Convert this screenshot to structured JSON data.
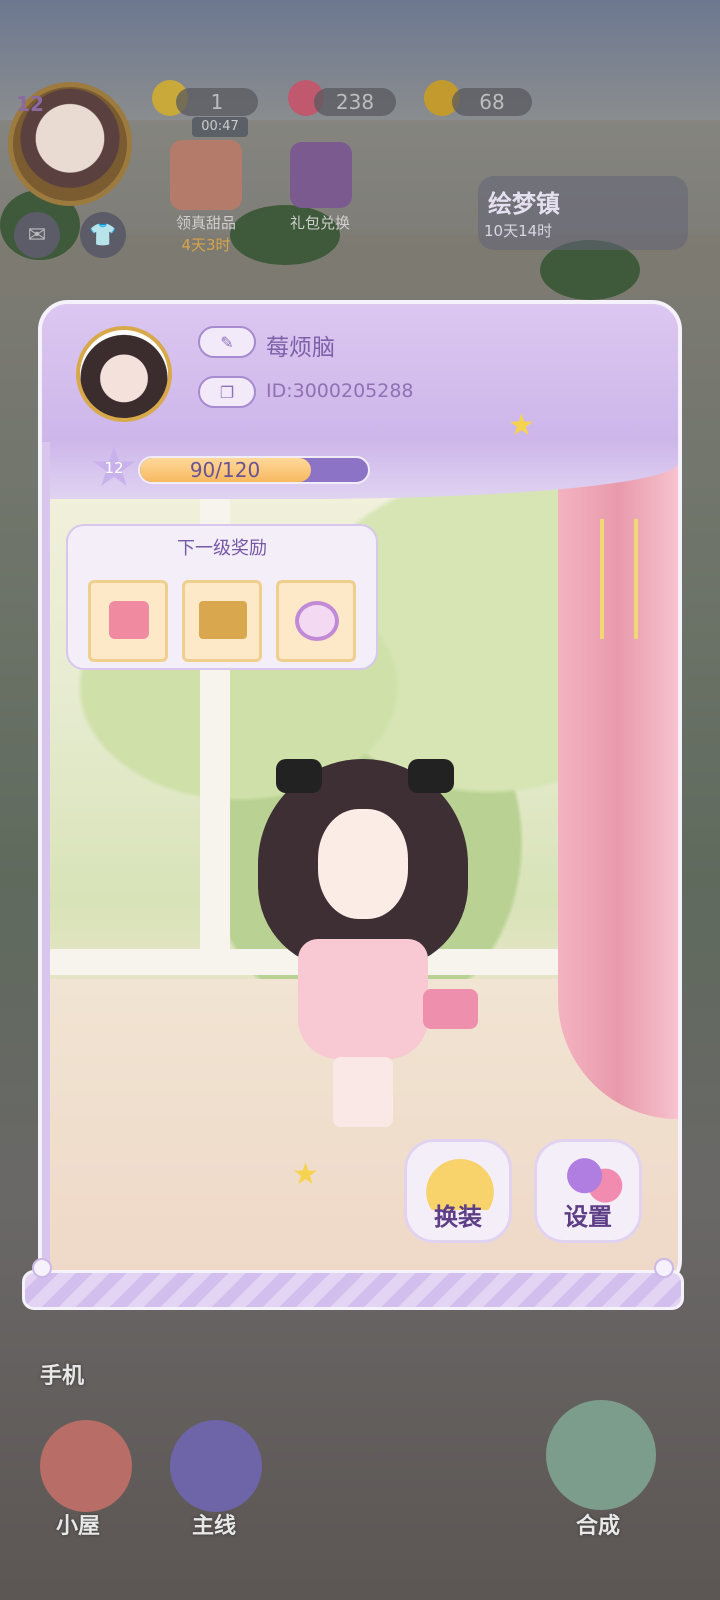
{
  "hud": {
    "player_level": "12",
    "energy": "1",
    "energy_timer": "00:47",
    "gems": "238",
    "coins": "68"
  },
  "events": [
    {
      "label": "领真甜品",
      "sub": "4天3时"
    },
    {
      "label": "礼包兑换",
      "sub": ""
    }
  ],
  "dream_town": {
    "label": "绘梦镇",
    "sub": "10天14时"
  },
  "side": {
    "phone_label": "手机"
  },
  "bottom_nav": [
    {
      "label": "小屋"
    },
    {
      "label": "主线"
    },
    {
      "label": "合成"
    }
  ],
  "profile": {
    "name": "莓烦脑",
    "id": "ID:3000205288",
    "level": "12",
    "xp_text": "90/120",
    "xp_fraction": 0.75,
    "reward_title": "下一级奖励",
    "rewards": [
      {
        "icon": "pink-bag-icon"
      },
      {
        "icon": "treasure-box-icon"
      },
      {
        "icon": "compact-mirror-icon"
      }
    ],
    "dressup_label": "换装",
    "settings_label": "设置"
  },
  "colors": {
    "panel_bg": "#d9c6ef",
    "accent": "#7d61a8",
    "xp_fill": "#f7b960"
  }
}
